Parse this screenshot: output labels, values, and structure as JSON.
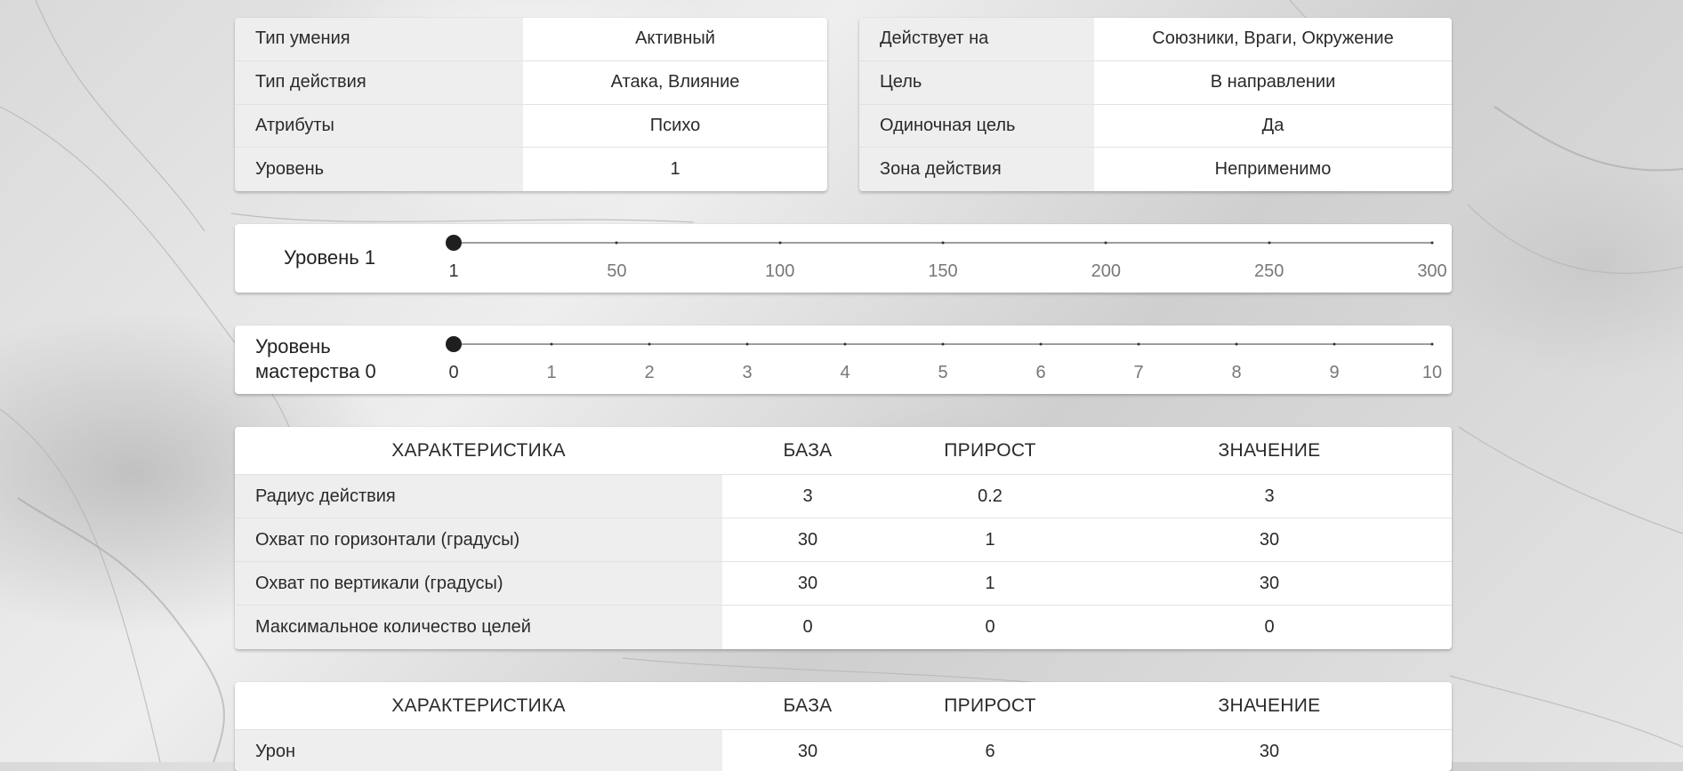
{
  "skill_info": [
    {
      "label": "Тип умения",
      "value": "Активный"
    },
    {
      "label": "Тип действия",
      "value": "Атака, Влияние"
    },
    {
      "label": "Атрибуты",
      "value": "Психо"
    },
    {
      "label": "Уровень",
      "value": "1"
    }
  ],
  "target_info": [
    {
      "label": "Действует на",
      "value": "Союзники, Враги, Окружение"
    },
    {
      "label": "Цель",
      "value": "В направлении"
    },
    {
      "label": "Одиночная цель",
      "value": "Да"
    },
    {
      "label": "Зона действия",
      "value": "Неприменимо"
    }
  ],
  "level_slider": {
    "label": "Уровень 1",
    "min": 1,
    "max": 300,
    "value": 1,
    "tick_labels": [
      "1",
      "50",
      "100",
      "150",
      "200",
      "250",
      "300"
    ],
    "tick_count": 7
  },
  "mastery_slider": {
    "label_line1": "Уровень",
    "label_line2": "мастерства 0",
    "min": 0,
    "max": 10,
    "value": 0,
    "tick_labels": [
      "0",
      "1",
      "2",
      "3",
      "4",
      "5",
      "6",
      "7",
      "8",
      "9",
      "10"
    ],
    "tick_count": 11
  },
  "stats_table_1": {
    "headers": [
      "ХАРАКТЕРИСТИКА",
      "БАЗА",
      "ПРИРОСТ",
      "ЗНАЧЕНИЕ"
    ],
    "rows": [
      [
        "Радиус действия",
        "3",
        "0.2",
        "3"
      ],
      [
        "Охват по горизонтали (градусы)",
        "30",
        "1",
        "30"
      ],
      [
        "Охват по вертикали (градусы)",
        "30",
        "1",
        "30"
      ],
      [
        "Максимальное количество целей",
        "0",
        "0",
        "0"
      ]
    ]
  },
  "stats_table_2": {
    "headers": [
      "ХАРАКТЕРИСТИКА",
      "БАЗА",
      "ПРИРОСТ",
      "ЗНАЧЕНИЕ"
    ],
    "rows": [
      [
        "Урон",
        "30",
        "6",
        "30"
      ]
    ]
  }
}
